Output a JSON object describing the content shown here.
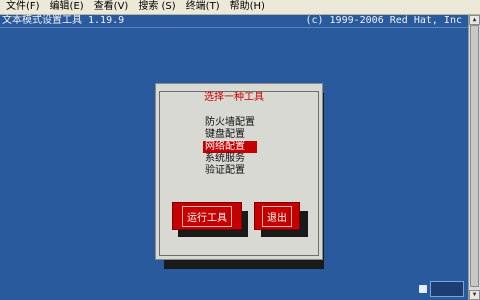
{
  "menubar": {
    "items": [
      "文件(F)",
      "编辑(E)",
      "查看(V)",
      "搜索 (S)",
      "终端(T)",
      "帮助(H)"
    ]
  },
  "status": {
    "left": "文本模式设置工具 1.19.9",
    "right": "(c) 1999-2006 Red Hat, Inc"
  },
  "dialog": {
    "title": "选择一种工具",
    "tools": [
      "防火墙配置",
      "键盘配置",
      "网络配置",
      "系统服务",
      "验证配置"
    ],
    "selected_index": 2,
    "buttons": {
      "run": "运行工具",
      "quit": "退出"
    }
  },
  "colors": {
    "terminal_bg": "#2a5a9e",
    "dialog_bg": "#d9d9d3",
    "accent_red": "#c40000"
  }
}
